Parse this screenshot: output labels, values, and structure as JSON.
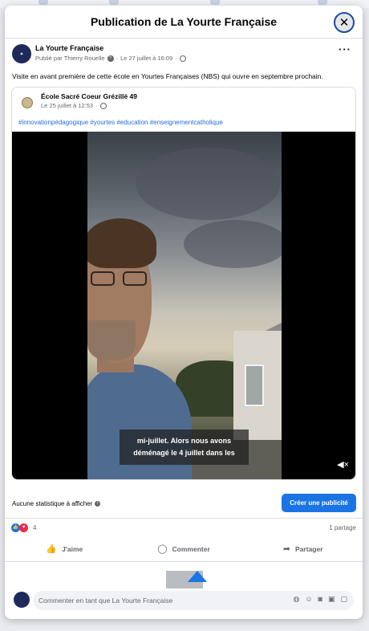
{
  "modal": {
    "title": "Publication de La Yourte Française",
    "close_icon": "close-icon"
  },
  "post": {
    "page_name": "La Yourte Française",
    "published_by": "Publié par Thierry Rouelle",
    "date": "Le 27 juillet à 16:09",
    "text": "Visite en avant première de cette école en Yourtes Françaises (NBS) qui ouvre en septembre prochain."
  },
  "shared_post": {
    "page_name": "École Sacré Coeur Grézillé 49",
    "date": "Le 25 juillet à 12:53",
    "hashtags": "#innovationpédagogique #yourtes #education #enseignementcatholique",
    "subtitle_line1": "mi-juillet. Alors nous avons",
    "subtitle_line2": "déménagé le 4 juillet dans les"
  },
  "stats": {
    "no_stats": "Aucune statistique à afficher",
    "create_ad": "Créer une publicité",
    "reaction_count": "4",
    "shares": "1 partage"
  },
  "actions": {
    "like": "J'aime",
    "comment": "Commenter",
    "share": "Partager"
  },
  "comment": {
    "placeholder": "Commenter en tant que La Yourte Française"
  },
  "colors": {
    "accent": "#1b74e4",
    "love": "#f02849"
  }
}
